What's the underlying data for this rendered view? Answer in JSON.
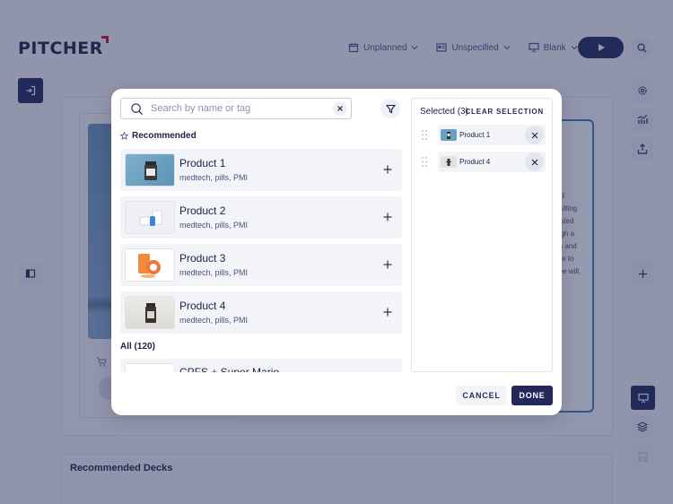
{
  "brand": {
    "name": "PITCHER",
    "accent_color": "#c8102e",
    "primary_color": "#22295a"
  },
  "topbar": {
    "date_select": {
      "label": "Unplanned",
      "icon": "calendar-icon"
    },
    "contact_select": {
      "label": "Unspecified",
      "icon": "contact-card-icon"
    },
    "presentation_select": {
      "label": "Blank",
      "icon": "presentation-icon"
    },
    "play_icon": "play-icon",
    "search_icon": "search-icon"
  },
  "right_rail": [
    "gear-icon",
    "analytics-icon",
    "upload-icon",
    "plus-icon",
    "presentation-icon",
    "layers-icon",
    "save-icon"
  ],
  "background": {
    "text_fragments": [
      "nd",
      "sulting",
      "ested",
      "ugh a",
      "ra and",
      "ble to",
      "ree will,"
    ],
    "recommended_decks_title": "Recommended Decks"
  },
  "modal": {
    "search": {
      "placeholder": "Search by name or tag",
      "value": ""
    },
    "recommended_label": "Recommended",
    "recommended": [
      {
        "name": "Product 1",
        "tags": "medtech, pills, PMI",
        "thumb": "blue"
      },
      {
        "name": "Product 2",
        "tags": "medtech, pills, PMI",
        "thumb": "white-blue"
      },
      {
        "name": "Product 3",
        "tags": "medtech, pills, PMI",
        "thumb": "orange"
      },
      {
        "name": "Product 4",
        "tags": "medtech, pills, PMI",
        "thumb": "grey"
      }
    ],
    "all_label": "All (120)",
    "all_first_item": "CPFS + Super Mario",
    "selected": {
      "title": "Selected (3)",
      "clear_label": "CLEAR SELECTION",
      "items": [
        {
          "name": "Product 1",
          "thumb": "blue"
        },
        {
          "name": "Product 4",
          "thumb": "grey"
        }
      ]
    },
    "cancel_label": "CANCEL",
    "done_label": "DONE"
  }
}
